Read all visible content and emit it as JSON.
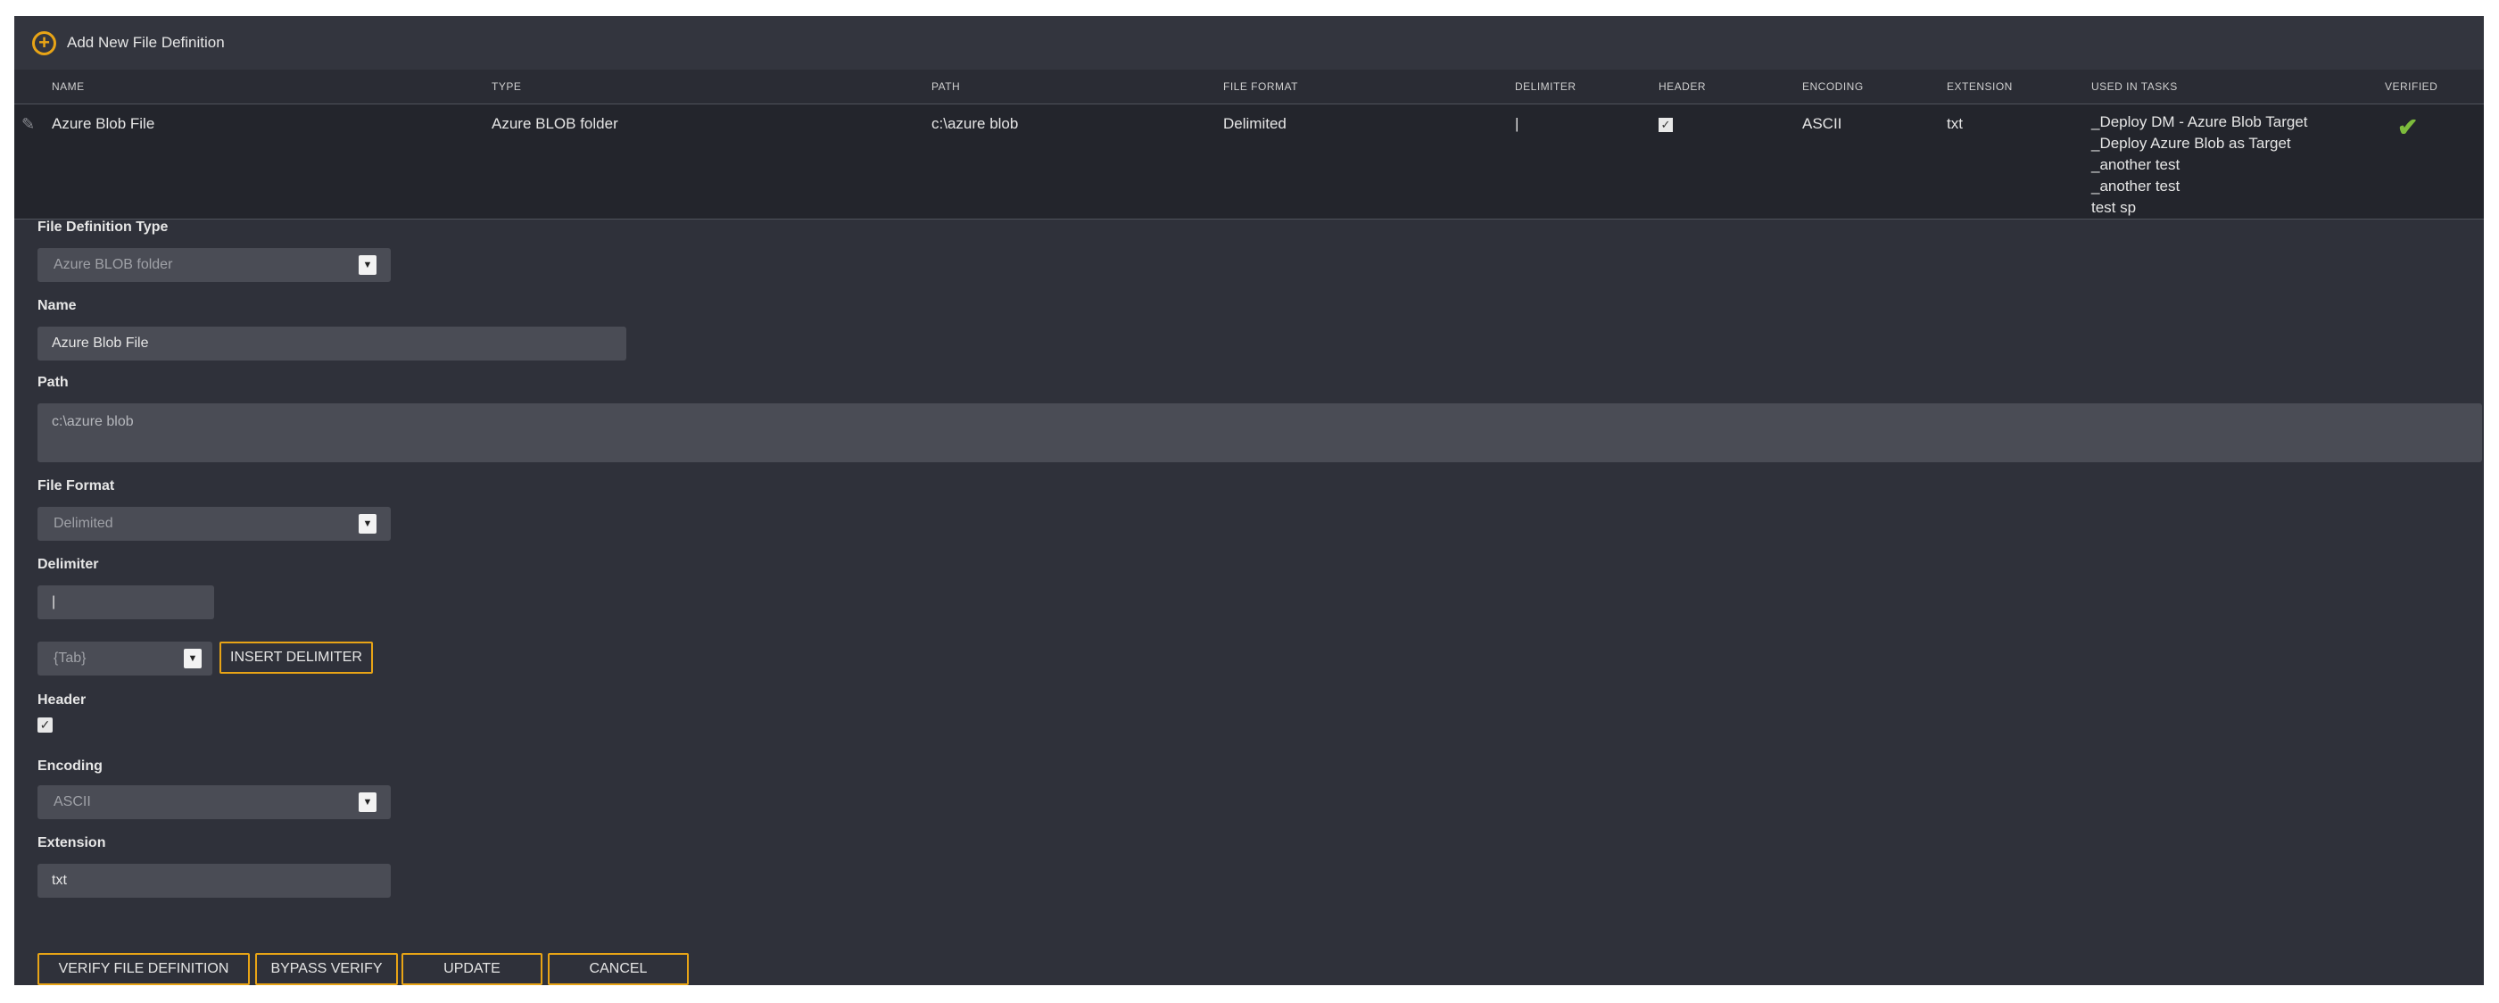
{
  "toolbar": {
    "add_label": "Add New File Definition"
  },
  "columns": [
    "NAME",
    "TYPE",
    "PATH",
    "FILE FORMAT",
    "DELIMITER",
    "HEADER",
    "ENCODING",
    "EXTENSION",
    "USED IN TASKS",
    "VERIFIED"
  ],
  "rows": [
    {
      "name": "Azure Blob File",
      "type": "Azure BLOB folder",
      "path": "c:\\azure blob",
      "file_format": "Delimited",
      "delimiter": "|",
      "header": "✓",
      "encoding": "ASCII",
      "extension": "txt",
      "tasks": [
        "_Deploy DM - Azure Blob Target",
        "_Deploy Azure Blob as Target",
        "_another test",
        "_another test",
        "test sp"
      ],
      "verified": "✔"
    }
  ],
  "icons": {
    "add": "plus-circle-icon",
    "edit": "pencil-icon",
    "verified": "checkmark-icon",
    "dropdown": "chevron-down-icon"
  },
  "colors": {
    "accent": "#e8a416",
    "verified": "#7dbb3c",
    "panel": "#2f313a"
  },
  "form": {
    "type_label": "File Definition Type",
    "type_value": "Azure BLOB folder",
    "name_label": "Name",
    "name_value": "Azure Blob File",
    "path_label": "Path",
    "path_value": "c:\\azure blob",
    "format_label": "File Format",
    "format_value": "Delimited",
    "delimiter_label": "Delimiter",
    "delimiter_value": "|",
    "delimiter_choice": "{Tab}",
    "insert_delimiter": "INSERT DELIMITER",
    "header_label": "Header",
    "header_checked": "✓",
    "encoding_label": "Encoding",
    "encoding_value": "ASCII",
    "extension_label": "Extension",
    "extension_value": "txt"
  },
  "actions": {
    "verify": "VERIFY FILE DEFINITION",
    "bypass": "BYPASS VERIFY",
    "update": "UPDATE",
    "cancel": "CANCEL"
  }
}
